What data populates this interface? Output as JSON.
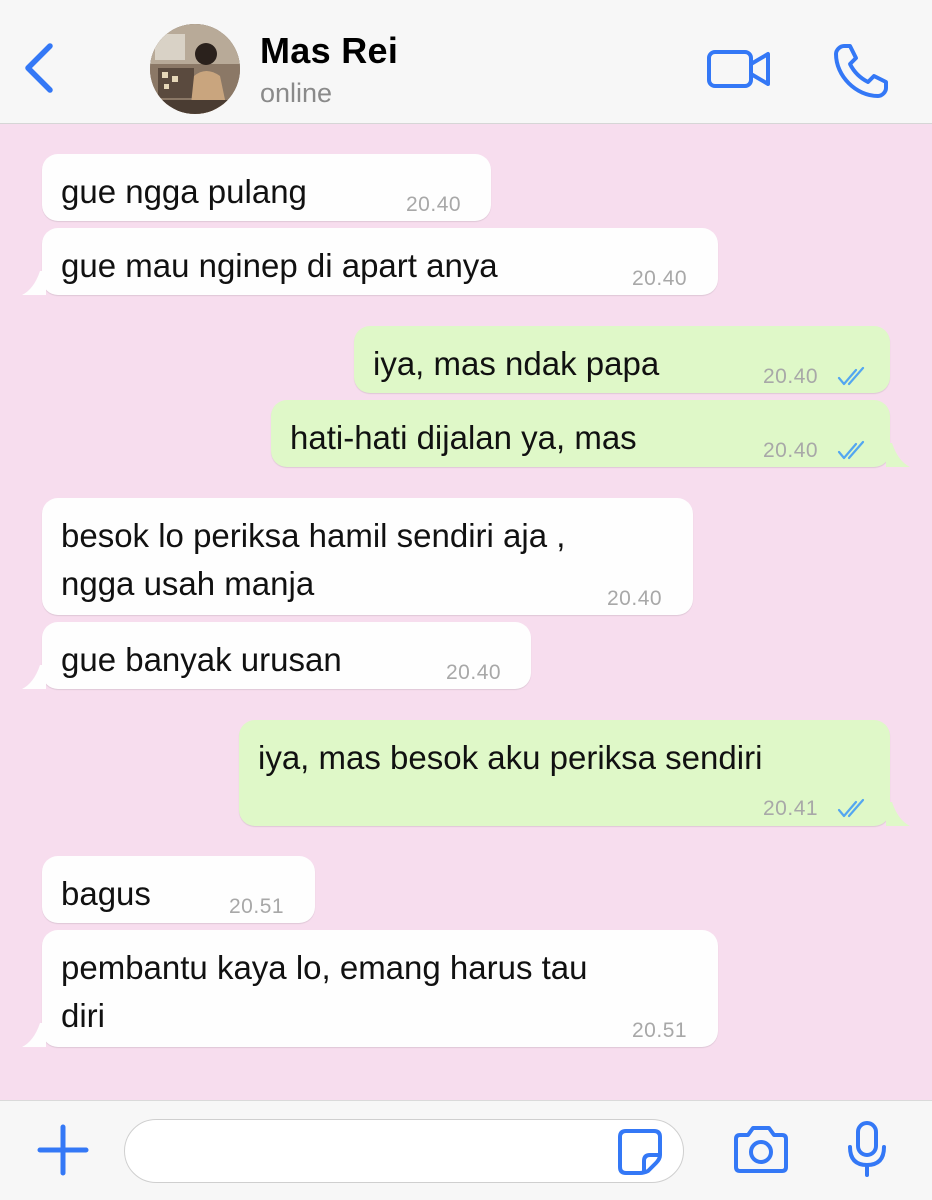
{
  "header": {
    "contact_name": "Mas Rei",
    "status": "online",
    "icons": {
      "back": "chevron-left-icon",
      "video": "video-camera-icon",
      "call": "phone-icon"
    }
  },
  "messages": [
    {
      "direction": "incoming",
      "lines": [
        "gue ngga pulang"
      ],
      "time": "20.40"
    },
    {
      "direction": "incoming",
      "lines": [
        "gue mau nginep di apart anya"
      ],
      "time": "20.40"
    },
    {
      "direction": "outgoing",
      "lines": [
        "iya, mas ndak papa"
      ],
      "time": "20.40",
      "read": true
    },
    {
      "direction": "outgoing",
      "lines": [
        "hati-hati dijalan ya, mas"
      ],
      "time": "20.40",
      "read": true
    },
    {
      "direction": "incoming",
      "lines": [
        "besok lo periksa hamil sendiri aja ,",
        "ngga usah manja"
      ],
      "time": "20.40"
    },
    {
      "direction": "incoming",
      "lines": [
        "gue banyak urusan"
      ],
      "time": "20.40"
    },
    {
      "direction": "outgoing",
      "lines": [
        "iya, mas besok aku periksa sendiri"
      ],
      "time": "20.41",
      "read": true
    },
    {
      "direction": "incoming",
      "lines": [
        "bagus"
      ],
      "time": "20.51"
    },
    {
      "direction": "incoming",
      "lines": [
        "pembantu kaya lo, emang harus tau",
        "diri"
      ],
      "time": "20.51"
    }
  ],
  "composer": {
    "input_value": "",
    "icons": {
      "attach": "plus-icon",
      "sticker": "sticker-icon",
      "camera": "camera-icon",
      "mic": "microphone-icon"
    }
  },
  "colors": {
    "accent": "#3478f6",
    "chat_background": "#f7ddee",
    "incoming_bubble": "#fefefe",
    "outgoing_bubble": "#dff8c8",
    "read_tick": "#53a6f0"
  }
}
